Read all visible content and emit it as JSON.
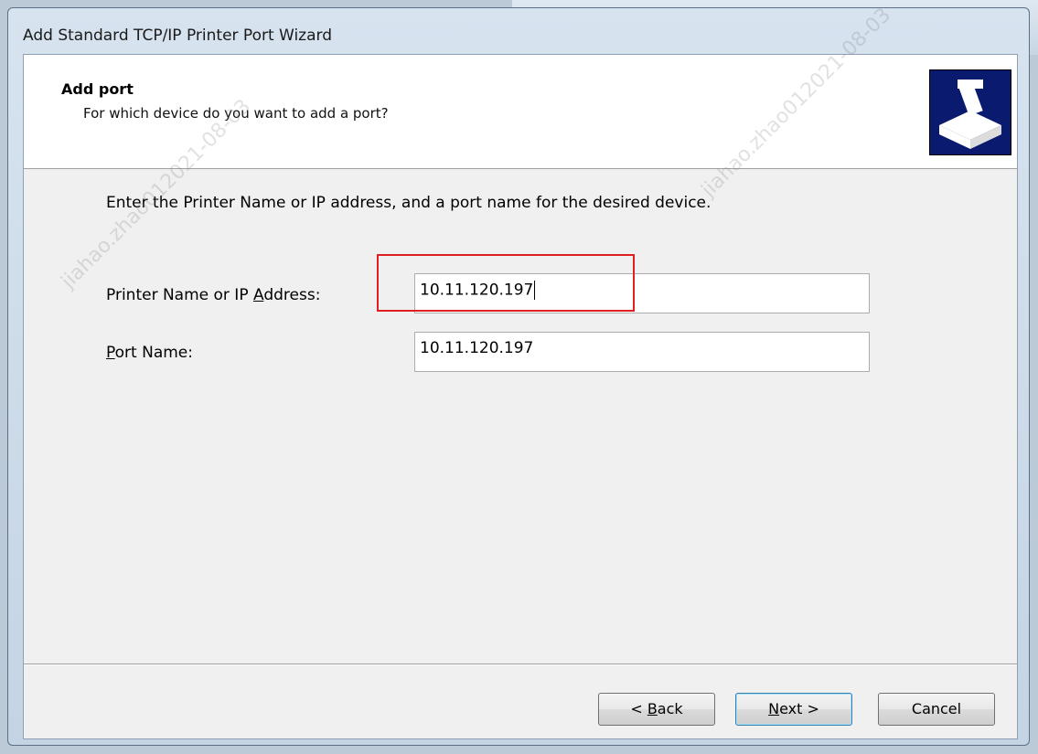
{
  "window": {
    "title": "Add Standard TCP/IP Printer Port Wizard"
  },
  "header": {
    "title": "Add port",
    "subtitle": "For which device do you want to add a port?",
    "icon": "printer-port-icon"
  },
  "body": {
    "instruction": "Enter the Printer Name or IP address, and a port name for the desired device.",
    "printer_label_pre": "Printer Name or IP ",
    "printer_label_key": "A",
    "printer_label_post": "ddress:",
    "printer_value": "10.11.120.197",
    "port_label_key": "P",
    "port_label_post": "ort Name:",
    "port_value": "10.11.120.197"
  },
  "buttons": {
    "back_pre": "< ",
    "back_key": "B",
    "back_post": "ack",
    "next_key": "N",
    "next_post": "ext >",
    "cancel": "Cancel"
  },
  "watermark": {
    "text_a": "jiahao.zhao012021-08-03",
    "text_b": "jiahao.zhao012021-08-03"
  },
  "colors": {
    "highlight": "#e02020",
    "header_icon_bg": "#0a1a6e"
  }
}
